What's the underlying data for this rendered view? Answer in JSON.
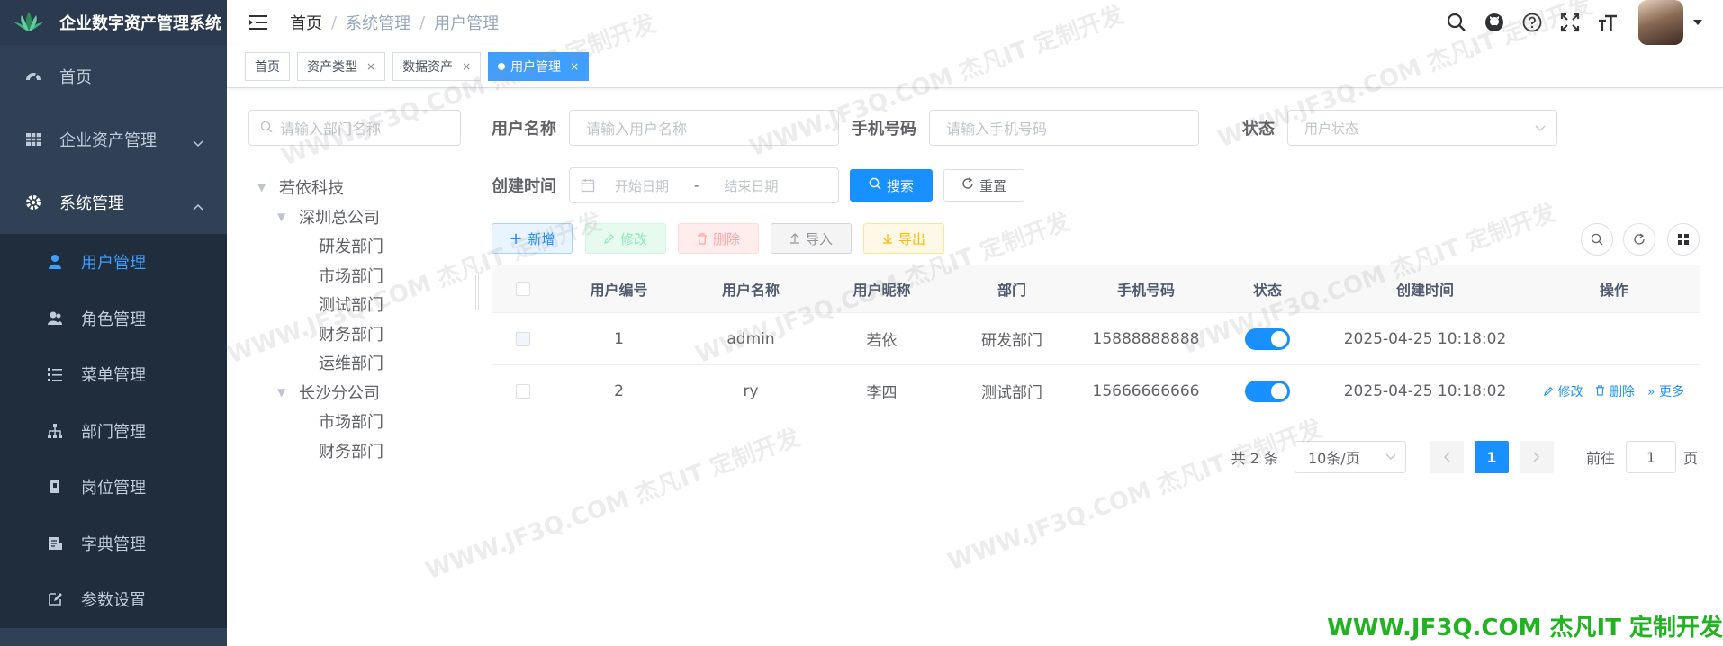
{
  "app": {
    "title": "企业数字资产管理系统"
  },
  "sidebar": {
    "items": [
      {
        "label": "首页",
        "icon": "dashboard-icon"
      },
      {
        "label": "企业资产管理",
        "icon": "grid-icon"
      },
      {
        "label": "系统管理",
        "icon": "gear-icon"
      }
    ],
    "sub_items": [
      {
        "label": "用户管理",
        "icon": "user-icon",
        "active": true
      },
      {
        "label": "角色管理",
        "icon": "users-icon"
      },
      {
        "label": "菜单管理",
        "icon": "list-icon"
      },
      {
        "label": "部门管理",
        "icon": "tree-icon"
      },
      {
        "label": "岗位管理",
        "icon": "badge-icon"
      },
      {
        "label": "字典管理",
        "icon": "book-icon"
      },
      {
        "label": "参数设置",
        "icon": "edit-icon"
      }
    ]
  },
  "breadcrumb": [
    "首页",
    "系统管理",
    "用户管理"
  ],
  "tags": [
    {
      "label": "首页"
    },
    {
      "label": "资产类型"
    },
    {
      "label": "数据资产"
    },
    {
      "label": "用户管理"
    }
  ],
  "dept": {
    "search_placeholder": "请输入部门名称",
    "tree": [
      {
        "label": "若依科技"
      },
      {
        "label": "深圳总公司"
      },
      {
        "label": "研发部门"
      },
      {
        "label": "市场部门"
      },
      {
        "label": "测试部门"
      },
      {
        "label": "财务部门"
      },
      {
        "label": "运维部门"
      },
      {
        "label": "长沙分公司"
      },
      {
        "label": "市场部门"
      },
      {
        "label": "财务部门"
      }
    ]
  },
  "search": {
    "username_label": "用户名称",
    "username_placeholder": "请输入用户名称",
    "phone_label": "手机号码",
    "phone_placeholder": "请输入手机号码",
    "status_label": "状态",
    "status_placeholder": "用户状态",
    "date_label": "创建时间",
    "date_start": "开始日期",
    "date_sep": "-",
    "date_end": "结束日期",
    "search_btn": "搜索",
    "reset_btn": "重置"
  },
  "toolbar": {
    "add": "新增",
    "edit": "修改",
    "delete": "删除",
    "import": "导入",
    "export": "导出"
  },
  "table": {
    "headers": [
      "用户编号",
      "用户名称",
      "用户昵称",
      "部门",
      "手机号码",
      "状态",
      "创建时间",
      "操作"
    ],
    "rows": [
      {
        "id": "1",
        "username": "admin",
        "nickname": "若依",
        "dept": "研发部门",
        "phone": "15888888888",
        "created": "2025-04-25 10:18:02",
        "status_on": true
      },
      {
        "id": "2",
        "username": "ry",
        "nickname": "李四",
        "dept": "测试部门",
        "phone": "15666666666",
        "created": "2025-04-25 10:18:02",
        "status_on": true
      }
    ],
    "ops": {
      "edit": "修改",
      "delete": "删除",
      "more": "更多"
    }
  },
  "pager": {
    "total": "共 2 条",
    "page_size": "10条/页",
    "current": "1",
    "goto_label": "前往",
    "goto_value": "1",
    "page_suffix": "页"
  },
  "watermark": {
    "text": "WWW.JF3Q.COM 杰凡IT 定制开发",
    "footer": "WWW.JF3Q.COM 杰凡IT 定制开发"
  },
  "colors": {
    "sidebar": "#304156",
    "primary": "#1890ff",
    "active_menu": "#409eff"
  }
}
